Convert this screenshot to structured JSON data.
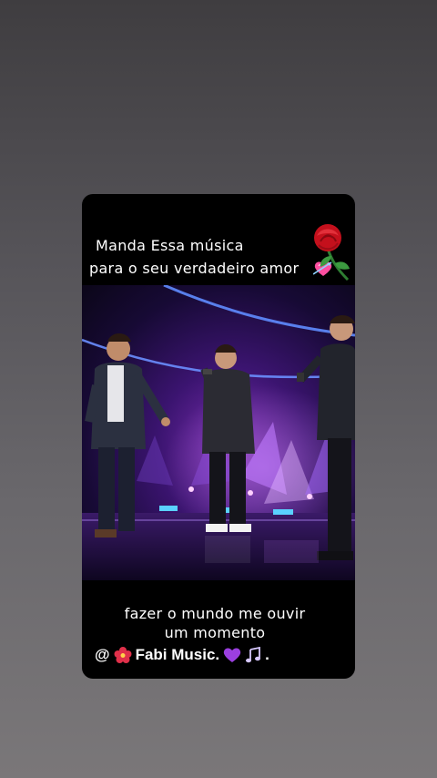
{
  "story": {
    "caption_top_line1": "Manda Essa música",
    "caption_top_line2": "para o seu verdadeiro amor",
    "caption_bottom_line1": "fazer o mundo me ouvir",
    "caption_bottom_line2": "um momento",
    "credit_at": "@",
    "credit_name": "Fabi Music.",
    "credit_end": "."
  },
  "icons": {
    "rose": "rose-icon",
    "heart": "heart-with-arrow-icon",
    "hibiscus": "hibiscus-icon",
    "purple_heart": "purple-heart-icon",
    "music_notes": "music-notes-icon"
  },
  "colors": {
    "background_top": "#3f3d40",
    "background_bottom": "#7a7779",
    "card": "#000000",
    "stage_purple": "#7a2fb0",
    "stage_light": "#4a7bff"
  }
}
